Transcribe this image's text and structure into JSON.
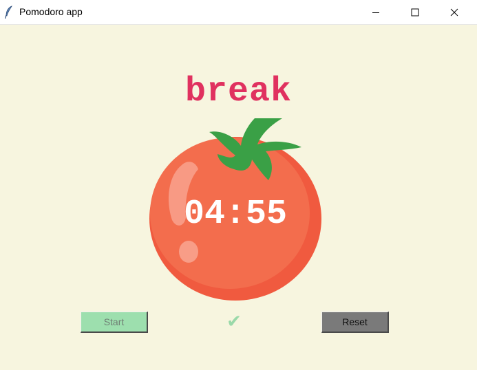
{
  "window": {
    "title": "Pomodoro app",
    "icon": "feather-icon",
    "controls": [
      "minimize-icon",
      "maximize-icon",
      "close-icon"
    ]
  },
  "main": {
    "mode_label": "break",
    "timer_text": "04:55",
    "checkmarks": "✔",
    "start_label": "Start",
    "reset_label": "Reset"
  },
  "colors": {
    "background": "#f7f5df",
    "mode_label": "#e0315f",
    "checkmark": "#9ad9a9",
    "start_button": "#9ddfae",
    "start_text": "#6f7f74",
    "reset_button": "#7a7a7a",
    "reset_text": "#111111",
    "tomato": "#f26b4c",
    "leaf": "#3aa046"
  }
}
